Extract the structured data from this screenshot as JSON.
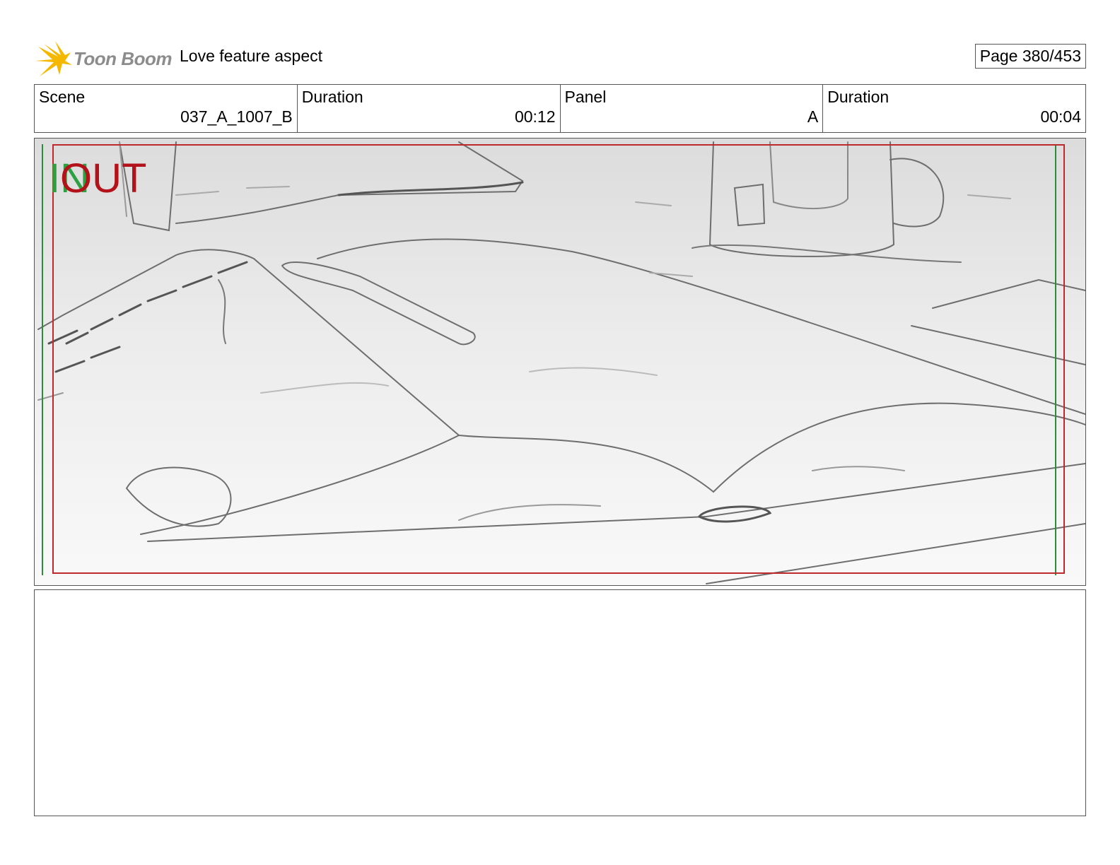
{
  "header": {
    "brand_name": "Toon Boom",
    "doc_title": "Love feature aspect",
    "page_indicator": "Page 380/453",
    "brand_colors": {
      "star": "#f5b800",
      "wordmark": "#8c8c8c"
    }
  },
  "info": {
    "scene_label": "Scene",
    "scene_value": "037_A_1007_B",
    "scene_duration_label": "Duration",
    "scene_duration_value": "00:12",
    "panel_label": "Panel",
    "panel_value": "A",
    "panel_duration_label": "Duration",
    "panel_duration_value": "00:04"
  },
  "panel": {
    "in_label": "IN",
    "out_label": "OUT",
    "colors": {
      "in": "#2da043",
      "out": "#b3121a",
      "frame_red": "#c0292b",
      "frame_green": "#2e8b3a"
    }
  },
  "notes": {
    "text": ""
  }
}
